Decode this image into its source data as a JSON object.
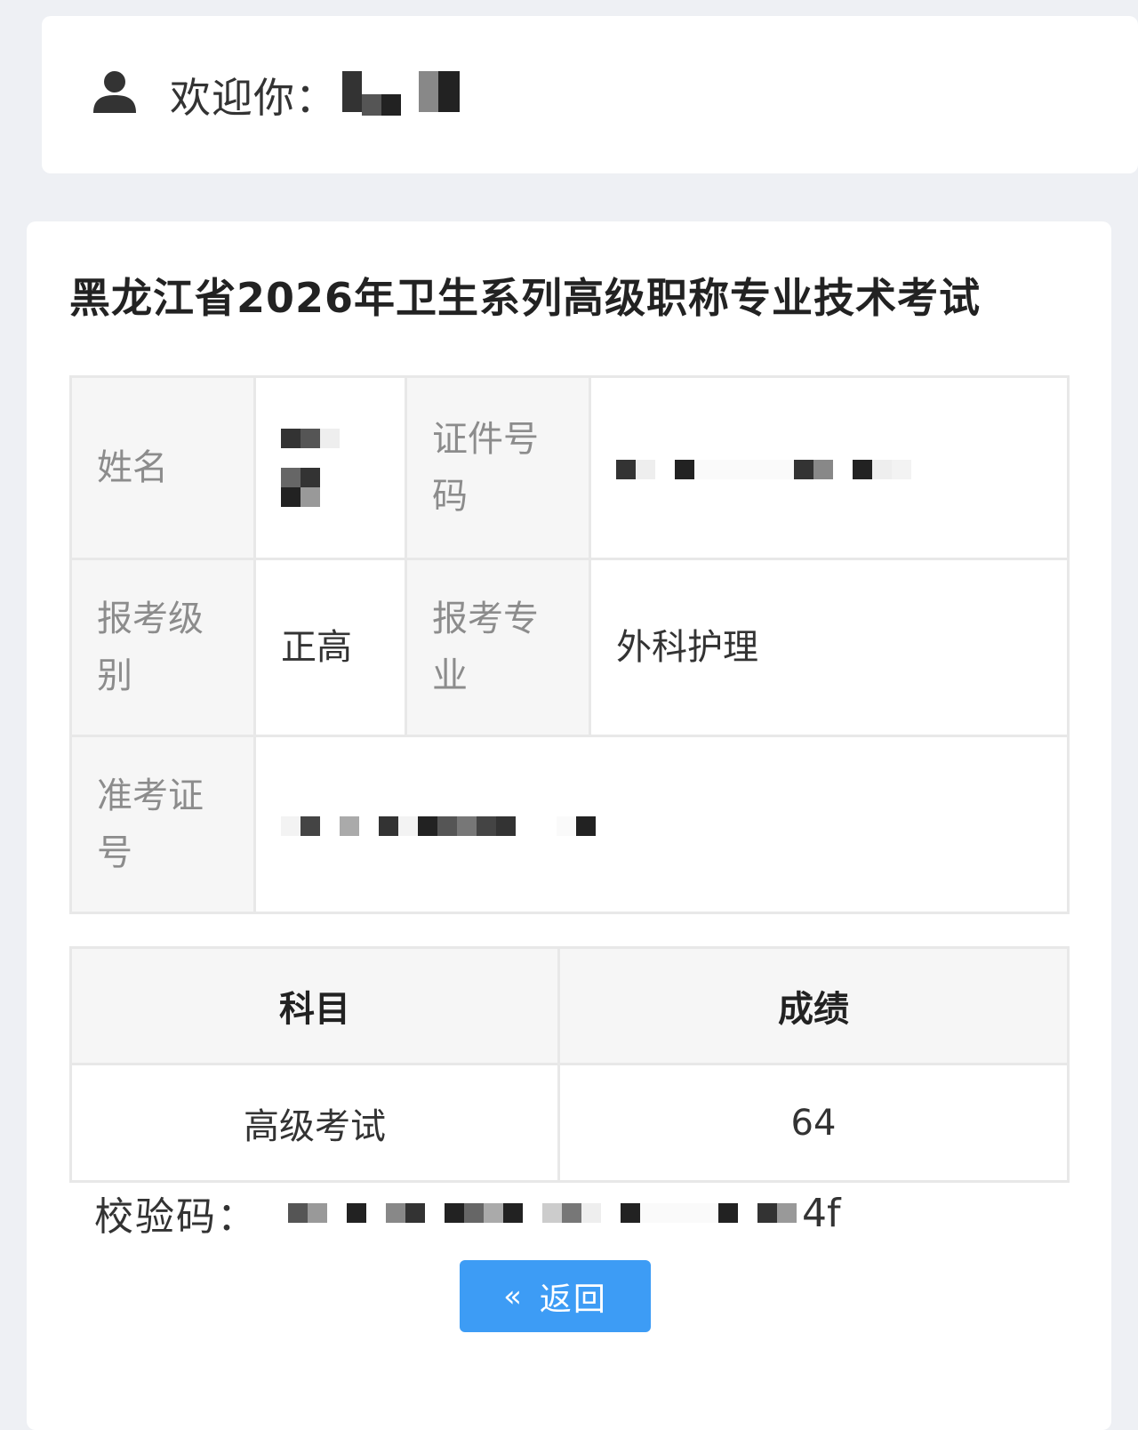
{
  "header": {
    "welcome_label": "欢迎你："
  },
  "exam": {
    "title": "黑龙江省2026年卫生系列高级职称专业技术考试"
  },
  "info": {
    "name_label": "姓名",
    "id_label": "证件号码",
    "level_label": "报考级别",
    "level_value": "正高",
    "major_label": "报考专业",
    "major_value": "外科护理",
    "ticket_label": "准考证号"
  },
  "scores": {
    "header_subject": "科目",
    "header_score": "成绩",
    "rows": [
      {
        "subject": "高级考试",
        "score": "64"
      }
    ]
  },
  "verify": {
    "label": "校验码：",
    "visible_suffix": "4f"
  },
  "actions": {
    "back_label": "返回",
    "back_icon": "double-chevron-left-icon"
  },
  "colors": {
    "accent": "#3d9cf5",
    "page_bg": "#eef0f4",
    "label_cell_bg": "#f6f6f6"
  }
}
